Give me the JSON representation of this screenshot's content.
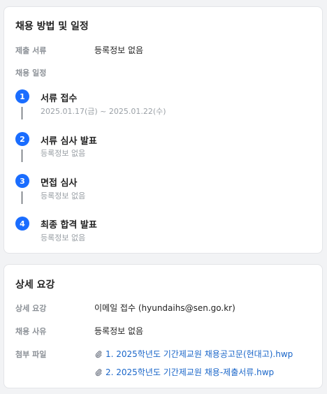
{
  "schedule_card": {
    "title": "채용 방법 및 일정",
    "documents_label": "제출 서류",
    "documents_value": "등록정보 없음",
    "schedule_label": "채용 일정",
    "steps": [
      {
        "number": "1",
        "title": "서류 접수",
        "detail": "2025.01.17(금) ~ 2025.01.22(수)"
      },
      {
        "number": "2",
        "title": "서류 심사 발표",
        "detail": "등록정보 없음"
      },
      {
        "number": "3",
        "title": "면접 심사",
        "detail": "등록정보 없음"
      },
      {
        "number": "4",
        "title": "최종 합격 발표",
        "detail": "등록정보 없음"
      }
    ]
  },
  "details_card": {
    "title": "상세 요강",
    "rows": [
      {
        "label": "상세 요강",
        "value": "이메일 접수 (hyundaihs@sen.go.kr)"
      },
      {
        "label": "채용 사유",
        "value": "등록정보 없음"
      }
    ],
    "attachments_label": "첨부 파일",
    "attachments": [
      "1. 2025학년도 기간제교원 채용공고문(현대고).hwp",
      "2. 2025학년도 기간제교원 채용-제출서류.hwp"
    ]
  },
  "colors": {
    "accent": "#1a6dff",
    "link": "#1a66c9",
    "muted": "#9aa0a6"
  }
}
